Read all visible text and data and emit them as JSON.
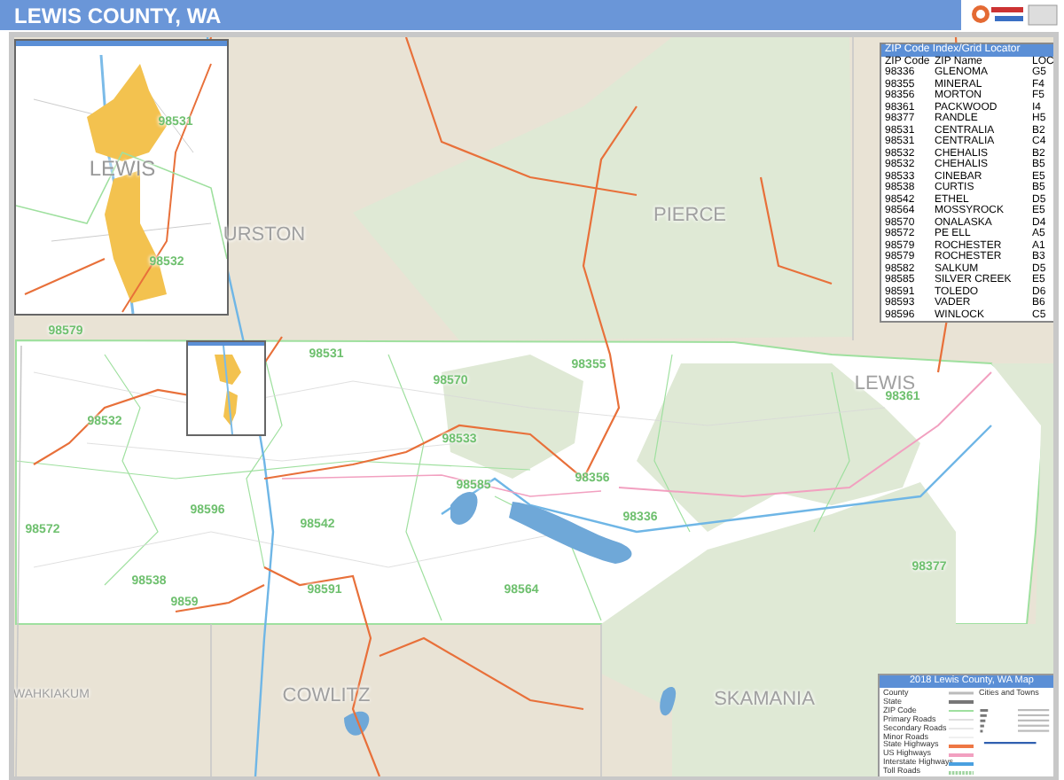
{
  "header": {
    "title": "LEWIS COUNTY, WA"
  },
  "map": {
    "county_labels": [
      "PIERCE",
      "URSTON",
      "LEWIS",
      "WAHKIAKUM",
      "COWLITZ",
      "SKAMANIA"
    ],
    "zip_labels": [
      "98579",
      "98531",
      "98570",
      "98532",
      "98355",
      "98533",
      "98585",
      "98356",
      "98596",
      "98542",
      "98336",
      "98361",
      "98572",
      "98538",
      "98591",
      "98564",
      "98377",
      "9859"
    ]
  },
  "inset": {
    "county_label": "LEWIS",
    "zip_labels": [
      "98531",
      "98532"
    ]
  },
  "zip_index": {
    "title": "ZIP Code Index/Grid Locator",
    "columns": [
      "ZIP Code",
      "ZIP Name",
      "LOC"
    ],
    "rows": [
      [
        "98336",
        "GLENOMA",
        "G5"
      ],
      [
        "98355",
        "MINERAL",
        "F4"
      ],
      [
        "98356",
        "MORTON",
        "F5"
      ],
      [
        "98361",
        "PACKWOOD",
        "I4"
      ],
      [
        "98377",
        "RANDLE",
        "H5"
      ],
      [
        "98531",
        "CENTRALIA",
        "B2"
      ],
      [
        "98531",
        "CENTRALIA",
        "C4"
      ],
      [
        "98532",
        "CHEHALIS",
        "B2"
      ],
      [
        "98532",
        "CHEHALIS",
        "B5"
      ],
      [
        "98533",
        "CINEBAR",
        "E5"
      ],
      [
        "98538",
        "CURTIS",
        "B5"
      ],
      [
        "98542",
        "ETHEL",
        "D5"
      ],
      [
        "98564",
        "MOSSYROCK",
        "E5"
      ],
      [
        "98570",
        "ONALASKA",
        "D4"
      ],
      [
        "98572",
        "PE ELL",
        "A5"
      ],
      [
        "98579",
        "ROCHESTER",
        "A1"
      ],
      [
        "98579",
        "ROCHESTER",
        "B3"
      ],
      [
        "98582",
        "SALKUM",
        "D5"
      ],
      [
        "98585",
        "SILVER CREEK",
        "E5"
      ],
      [
        "98591",
        "TOLEDO",
        "D6"
      ],
      [
        "98593",
        "VADER",
        "B6"
      ],
      [
        "98596",
        "WINLOCK",
        "C5"
      ]
    ]
  },
  "legend": {
    "title": "2018 Lewis County, WA Map",
    "cities_heading": "Cities and Towns",
    "items": [
      {
        "label": "County",
        "kind": "county"
      },
      {
        "label": "State",
        "kind": "state"
      },
      {
        "label": "ZIP Code",
        "kind": "zip"
      },
      {
        "label": "Primary Roads",
        "kind": "primary"
      },
      {
        "label": "Secondary Roads",
        "kind": "secondary"
      },
      {
        "label": "Minor Roads",
        "kind": "minor"
      },
      {
        "label": "State Highways",
        "kind": "state_hwy"
      },
      {
        "label": "US Highways",
        "kind": "us_hwy"
      },
      {
        "label": "Interstate Highways",
        "kind": "interstate"
      },
      {
        "label": "Toll Roads",
        "kind": "toll"
      }
    ]
  }
}
